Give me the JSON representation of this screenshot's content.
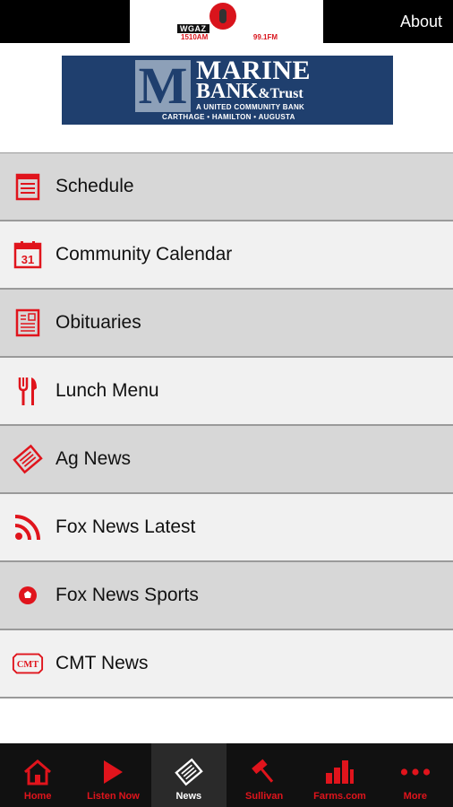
{
  "header": {
    "station_call": "WGAZ",
    "station_am": "1510AM",
    "station_fm": "99.1FM",
    "about_label": "About"
  },
  "sponsor": {
    "letter": "M",
    "line1": "MARINE",
    "line2": "BANK",
    "line2_suffix": "&Trust",
    "tagline": "A UNITED COMMUNITY BANK",
    "towns": "CARTHAGE • HAMILTON • AUGUSTA"
  },
  "menu": [
    {
      "label": "Schedule",
      "icon": "schedule-icon"
    },
    {
      "label": "Community Calendar",
      "icon": "calendar-icon",
      "icon_text": "31"
    },
    {
      "label": "Obituaries",
      "icon": "obituaries-icon"
    },
    {
      "label": "Lunch Menu",
      "icon": "fork-knife-icon"
    },
    {
      "label": "Ag News",
      "icon": "newspaper-icon"
    },
    {
      "label": "Fox News Latest",
      "icon": "rss-icon"
    },
    {
      "label": "Fox News Sports",
      "icon": "soccer-ball-icon"
    },
    {
      "label": "CMT News",
      "icon": "cmt-icon",
      "icon_text": "CMT"
    }
  ],
  "tabs": [
    {
      "label": "Home",
      "icon": "home-icon"
    },
    {
      "label": "Listen Now",
      "icon": "play-icon"
    },
    {
      "label": "News",
      "icon": "newspaper-icon",
      "active": true
    },
    {
      "label": "Sullivan",
      "icon": "gavel-icon"
    },
    {
      "label": "Farms.com",
      "icon": "bar-chart-icon"
    },
    {
      "label": "More",
      "icon": "more-dots-icon"
    }
  ],
  "colors": {
    "accent": "#e0141c",
    "header_bg": "#000000",
    "banner_bg": "#1f3f6e",
    "row_dark": "#d7d7d7",
    "row_light": "#f1f1f1",
    "tabbar_bg": "#111111"
  }
}
